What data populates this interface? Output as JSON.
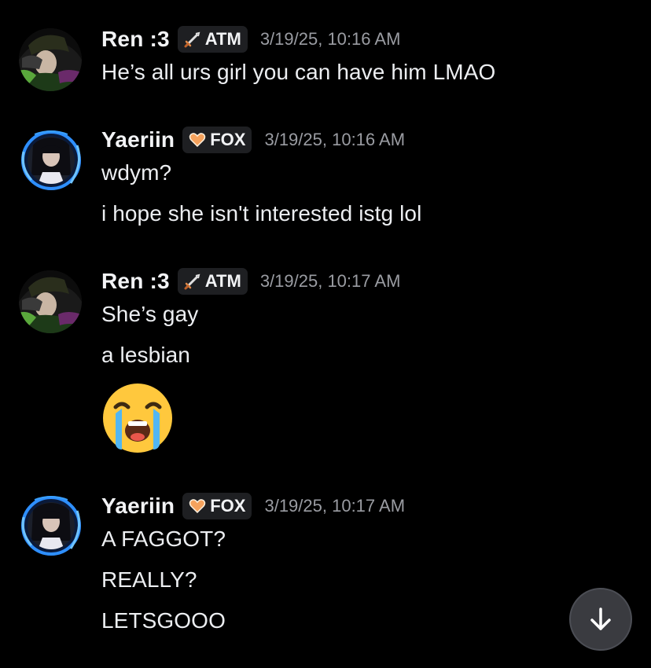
{
  "messages": [
    {
      "username": "Ren :3",
      "tag": "ATM",
      "tag_icon": "sword-icon",
      "timestamp": "3/19/25, 10:16 AM",
      "lines": [
        "He’s all urs girl you can have him LMAO"
      ]
    },
    {
      "username": "Yaeriin",
      "tag": "FOX",
      "tag_icon": "heart-icon",
      "timestamp": "3/19/25, 10:16 AM",
      "lines": [
        "wdym?",
        "i hope she isn't interested istg lol"
      ]
    },
    {
      "username": "Ren :3",
      "tag": "ATM",
      "tag_icon": "sword-icon",
      "timestamp": "3/19/25, 10:17 AM",
      "lines": [
        "She’s gay",
        "a lesbian"
      ],
      "emoji": "loudly-crying-face"
    },
    {
      "username": "Yaeriin",
      "tag": "FOX",
      "tag_icon": "heart-icon",
      "timestamp": "3/19/25, 10:17 AM",
      "lines": [
        "A FAGGOT?",
        "REALLY?",
        "LETSGOOO"
      ]
    }
  ],
  "scroll_button": {
    "icon": "arrow-down-icon"
  },
  "colors": {
    "background": "#000000",
    "text": "#f2f3f5",
    "timestamp": "#9a9ca2",
    "tag_bg": "#1e1f22",
    "heart": "#f5a25d",
    "avatar_glow": "#2e8fff"
  }
}
